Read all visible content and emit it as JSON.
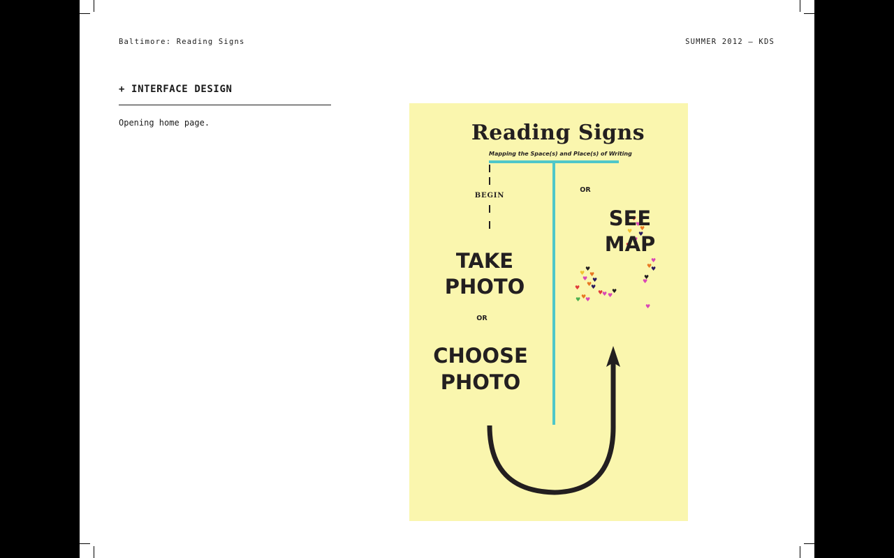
{
  "header": {
    "left": "Baltimore: Reading Signs",
    "right": "SUMMER 2012 – KDS"
  },
  "section": {
    "title": "+ INTERFACE DESIGN",
    "caption": "Opening home page."
  },
  "mockup": {
    "background": "#faf6ae",
    "accent": "#4ec7c9",
    "title": "Reading Signs",
    "subtitle": "Mapping the Space(s) and Place(s) of Writing",
    "begin": "BEGIN",
    "or_right": "OR",
    "take_photo_line1": "TAKE",
    "take_photo_line2": "PHOTO",
    "or_left": "OR",
    "choose_photo_line1": "CHOOSE",
    "choose_photo_line2": "PHOTO",
    "see_map_line1": "SEE",
    "see_map_line2": "MAP",
    "map_marker_icon": "heart-icon"
  }
}
